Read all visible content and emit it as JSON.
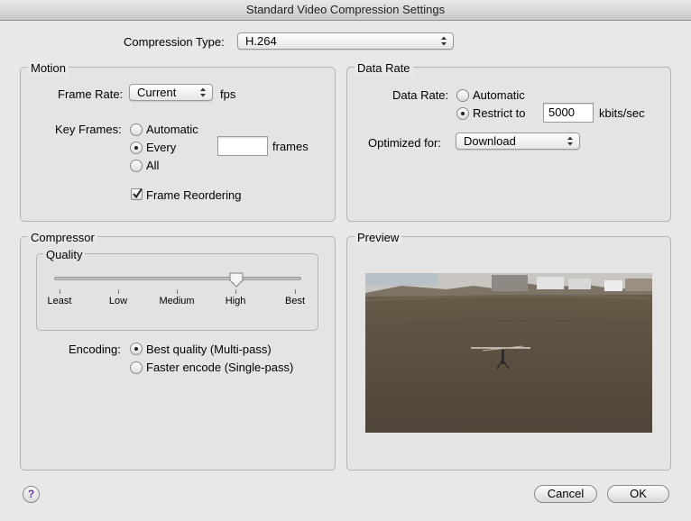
{
  "window": {
    "title": "Standard Video Compression Settings"
  },
  "compression": {
    "label": "Compression Type:",
    "value": "H.264"
  },
  "motion": {
    "title": "Motion",
    "frame_rate_label": "Frame Rate:",
    "frame_rate_value": "Current",
    "fps_label": "fps",
    "key_frames_label": "Key Frames:",
    "key_frames_options": [
      "Automatic",
      "Every",
      "All"
    ],
    "key_frames_selected": "Every",
    "frames_value": "",
    "frames_label": "frames",
    "frame_reordering_label": "Frame Reordering",
    "frame_reordering_checked": true
  },
  "data_rate": {
    "title": "Data Rate",
    "label": "Data Rate:",
    "options": [
      "Automatic",
      "Restrict to"
    ],
    "selected": "Restrict to",
    "value": "5000",
    "unit": "kbits/sec",
    "optimized_label": "Optimized for:",
    "optimized_value": "Download"
  },
  "compressor": {
    "title": "Compressor",
    "quality_title": "Quality",
    "quality_ticks": [
      "Least",
      "Low",
      "Medium",
      "High",
      "Best"
    ],
    "quality_level": 0.75,
    "encoding_label": "Encoding:",
    "encoding_options": [
      "Best quality (Multi-pass)",
      "Faster encode (Single-pass)"
    ],
    "encoding_selected": "Best quality (Multi-pass)"
  },
  "preview": {
    "title": "Preview"
  },
  "buttons": {
    "help": "?",
    "cancel": "Cancel",
    "ok": "OK"
  }
}
